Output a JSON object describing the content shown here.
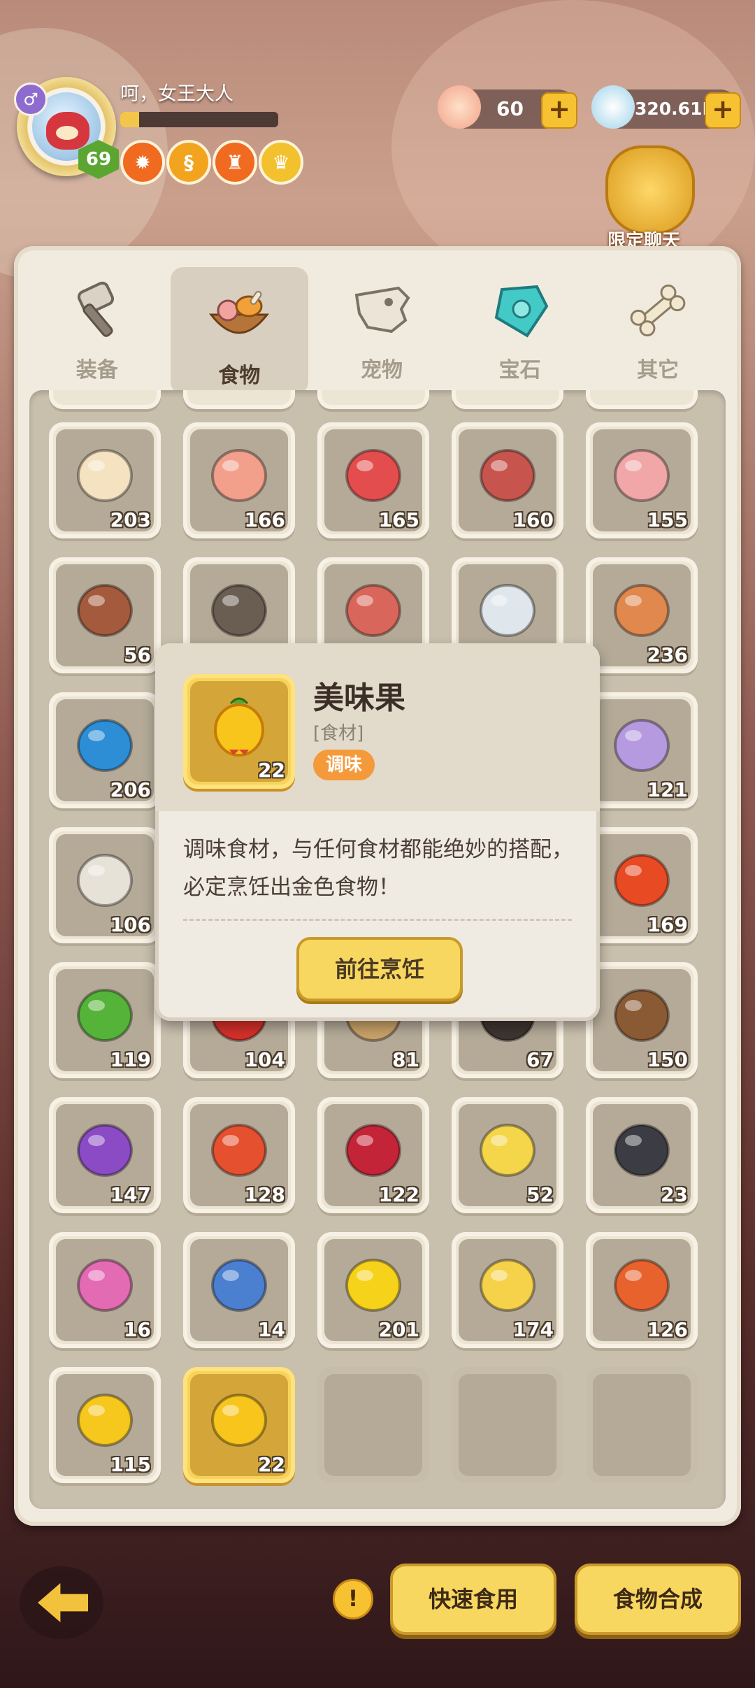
{
  "player": {
    "name": "呵，女王大人",
    "level": "69",
    "gender_symbol": "♂",
    "exp_fraction": 0.12
  },
  "currency": {
    "shells": "60",
    "pearls": "320.61M",
    "plus": "+"
  },
  "chat": {
    "label": "限定聊天"
  },
  "tabs": [
    {
      "label": "装备",
      "icon": "hammer-icon",
      "active": false
    },
    {
      "label": "食物",
      "icon": "food-bowl-icon",
      "active": true
    },
    {
      "label": "宠物",
      "icon": "dino-skull-icon",
      "active": false
    },
    {
      "label": "宝石",
      "icon": "gem-icon",
      "active": false
    },
    {
      "label": "其它",
      "icon": "bone-icon",
      "active": false
    }
  ],
  "items": [
    {
      "name": "egg",
      "count": "203"
    },
    {
      "name": "drumstick",
      "count": "166"
    },
    {
      "name": "ham",
      "count": "165"
    },
    {
      "name": "meat-leg",
      "count": "160"
    },
    {
      "name": "ribs",
      "count": "155"
    },
    {
      "name": "spiky-meat",
      "count": "56"
    },
    {
      "name": "rock-meat",
      "count": ""
    },
    {
      "name": "meat-slabs",
      "count": ""
    },
    {
      "name": "bone-fish",
      "count": ""
    },
    {
      "name": "fish",
      "count": "236"
    },
    {
      "name": "lobster",
      "count": "206"
    },
    {
      "name": "",
      "count": ""
    },
    {
      "name": "",
      "count": ""
    },
    {
      "name": "",
      "count": ""
    },
    {
      "name": "octopus",
      "count": "121"
    },
    {
      "name": "swordfish",
      "count": "106"
    },
    {
      "name": "",
      "count": ""
    },
    {
      "name": "",
      "count": ""
    },
    {
      "name": "",
      "count": ""
    },
    {
      "name": "tomato",
      "count": "169"
    },
    {
      "name": "broccoli",
      "count": "119"
    },
    {
      "name": "chili",
      "count": "104"
    },
    {
      "name": "mushroom",
      "count": "81"
    },
    {
      "name": "truffle",
      "count": "67"
    },
    {
      "name": "coconut",
      "count": "150"
    },
    {
      "name": "grapes",
      "count": "147"
    },
    {
      "name": "apple",
      "count": "128"
    },
    {
      "name": "pomegranate",
      "count": "122"
    },
    {
      "name": "pineapple",
      "count": "52"
    },
    {
      "name": "claw",
      "count": "23"
    },
    {
      "name": "pink-snail",
      "count": "16"
    },
    {
      "name": "crystal-fruit",
      "count": "14"
    },
    {
      "name": "lemon",
      "count": "201"
    },
    {
      "name": "cheese",
      "count": "174"
    },
    {
      "name": "herb",
      "count": "126"
    },
    {
      "name": "honeycomb",
      "count": "115"
    },
    {
      "name": "tasty-fruit",
      "count": "22",
      "selected": true
    },
    {
      "name": "empty",
      "count": ""
    },
    {
      "name": "empty",
      "count": ""
    },
    {
      "name": "empty",
      "count": ""
    }
  ],
  "popup": {
    "title": "美味果",
    "type": "[食材]",
    "tag": "调味",
    "count": "22",
    "description": "调味食材，与任何食材都能绝妙的搭配，必定烹饪出金色食物！",
    "button": "前往烹饪"
  },
  "bottom": {
    "info": "!",
    "quick_eat": "快速食用",
    "food_synth": "食物合成"
  },
  "colors": {
    "accent": "#f8d760",
    "tag": "#f49a3a",
    "panel": "#f1ebdf"
  }
}
